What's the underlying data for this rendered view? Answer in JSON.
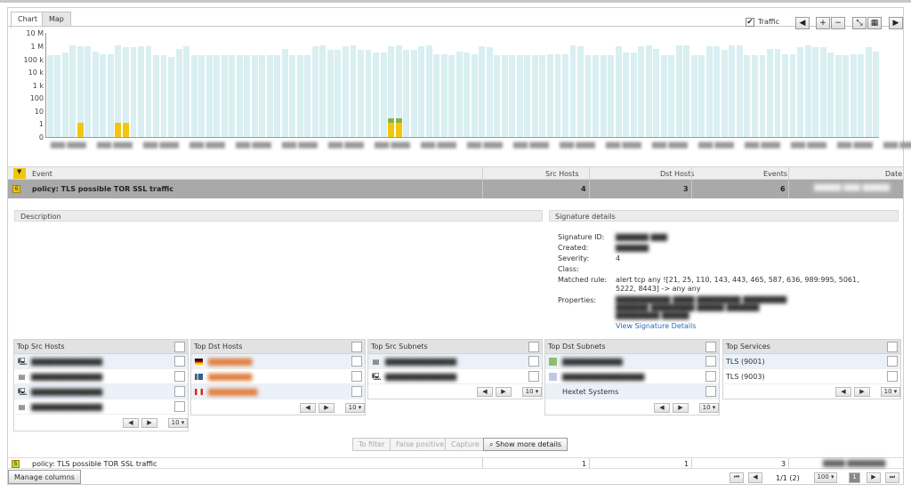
{
  "tabs": [
    {
      "label": "Chart"
    },
    {
      "label": "Map"
    }
  ],
  "toolbar": {
    "traffic_label": "Traffic",
    "traffic_checked": "✔"
  },
  "chart": {
    "y_ticks": [
      "10 M",
      "1 M",
      "100 k",
      "10 k",
      "1 k",
      "100",
      "10",
      "1",
      "0"
    ],
    "traffic_bars_log10": [
      5.3,
      5.3,
      5.5,
      6.1,
      6.0,
      6.0,
      5.6,
      5.4,
      5.4,
      6.1,
      5.9,
      5.9,
      6.0,
      6.0,
      5.3,
      5.3,
      5.2,
      5.8,
      6.0,
      5.3,
      5.3,
      5.3,
      5.3,
      5.3,
      5.3,
      5.3,
      5.3,
      5.3,
      5.3,
      5.3,
      5.3,
      5.8,
      5.3,
      5.3,
      5.3,
      6.0,
      6.1,
      5.7,
      5.7,
      6.0,
      6.1,
      5.7,
      5.7,
      5.5,
      5.5,
      6.0,
      6.1,
      5.7,
      5.7,
      6.0,
      6.1,
      5.4,
      5.4,
      5.3,
      5.6,
      5.5,
      5.4,
      6.0,
      5.9,
      5.3,
      5.3,
      5.3,
      5.3,
      5.3,
      5.3,
      5.3,
      5.4,
      5.4,
      5.4,
      6.1,
      6.0,
      5.3,
      5.3,
      5.3,
      5.3,
      6.0,
      5.5,
      5.5,
      6.0,
      6.1,
      5.8,
      5.3,
      5.3,
      6.1,
      6.1,
      5.3,
      5.3,
      6.0,
      6.0,
      5.7,
      6.1,
      6.1,
      5.3,
      5.3,
      5.3,
      5.8,
      5.8,
      5.4,
      5.4,
      5.9,
      6.1,
      5.9,
      5.9,
      5.5,
      5.3,
      5.3,
      5.4,
      5.4,
      5.9,
      5.6
    ],
    "event_bars": [
      {
        "index": 4,
        "value": 1
      },
      {
        "index": 9,
        "value": 1
      },
      {
        "index": 10,
        "value": 1
      },
      {
        "index": 45,
        "value": 3
      },
      {
        "index": 46,
        "value": 3
      }
    ]
  },
  "table": {
    "headers": {
      "event": "Event",
      "src_hosts": "Src Hosts",
      "dst_hosts": "Dst Hosts",
      "events": "Events",
      "date": "Date"
    },
    "rows": [
      {
        "badge": "6",
        "event": "policy: TLS possible TOR SSL traffic",
        "src_hosts": "4",
        "dst_hosts": "3",
        "events": "6"
      },
      {
        "badge": "5",
        "event": "policy: TLS possible TOR SSL traffic",
        "src_hosts": "1",
        "dst_hosts": "1",
        "events": "3"
      }
    ]
  },
  "detail": {
    "description_title": "Description",
    "signature_title": "Signature details",
    "labels": {
      "signature_id": "Signature ID:",
      "created": "Created:",
      "severity": "Severity:",
      "class": "Class:",
      "matched_rule": "Matched rule:",
      "properties": "Properties:"
    },
    "severity": "4",
    "matched_rule_line1": "alert tcp any ![21, 25, 110, 143, 443, 465, 587, 636, 989:995, 5061,",
    "matched_rule_line2": "5222, 8443] -> any any",
    "view_signature_link": "View Signature Details"
  },
  "subpanels": {
    "src_hosts": {
      "title": "Top Src Hosts",
      "page_size": "10 ▾"
    },
    "dst_hosts": {
      "title": "Top Dst Hosts",
      "page_size": "10 ▾"
    },
    "src_subnets": {
      "title": "Top Src Subnets",
      "page_size": "10 ▾"
    },
    "dst_subnets": {
      "title": "Top Dst Subnets",
      "page_size": "10 ▾",
      "row3": "Hextet Systems"
    },
    "services": {
      "title": "Top Services",
      "page_size": "10 ▾",
      "rows": [
        "TLS (9001)",
        "TLS (9003)"
      ]
    }
  },
  "actions": {
    "to_filter": "To filter",
    "false_positive": "False positive",
    "capture": "Capture",
    "show_more": "Show more details"
  },
  "footer": {
    "manage_columns": "Manage columns",
    "pager": "1/1 (2)",
    "page_size": "100 ▾",
    "current_page": "1"
  }
}
